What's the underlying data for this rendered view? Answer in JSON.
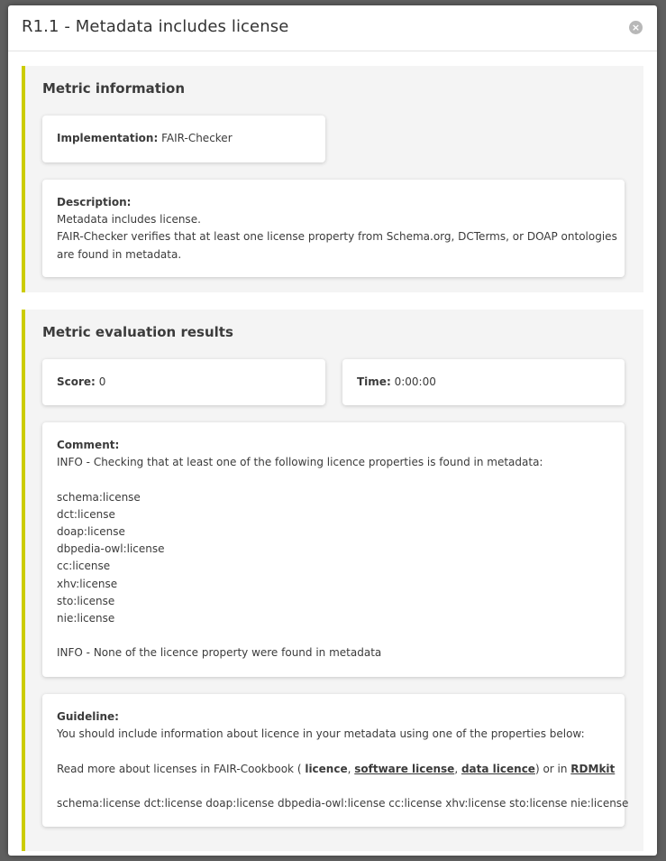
{
  "modal": {
    "title": "R1.1 - Metadata includes license",
    "close_icon": "×"
  },
  "metric_info": {
    "heading": "Metric information",
    "implementation_label": "Implementation:",
    "implementation_value": "FAIR-Checker",
    "description_label": "Description:",
    "description_lines": [
      "Metadata includes license.",
      "FAIR-Checker verifies that at least one license property from Schema.org, DCTerms, or DOAP ontologies",
      "are found in metadata."
    ]
  },
  "results": {
    "heading": "Metric evaluation results",
    "score_label": "Score:",
    "score_value": "0",
    "time_label": "Time:",
    "time_value": "0:00:00",
    "comment_label": "Comment:",
    "comment_intro": "INFO - Checking that at least one of the following licence properties is found in metadata:",
    "properties": [
      "schema:license",
      "dct:license",
      "doap:license",
      "dbpedia-owl:license",
      "cc:license",
      "xhv:license",
      "sto:license",
      "nie:license"
    ],
    "comment_result": "INFO - None of the licence property were found in metadata",
    "guideline_label": "Guideline:",
    "guideline_text": "You should include information about licence in your metadata using one of the properties below:",
    "read_more_prefix": "Read more about licenses in FAIR-Cookbook ( ",
    "link_licence": "licence",
    "sep1": ", ",
    "link_software_license": "software license",
    "sep2": ", ",
    "link_data_licence": "data licence",
    "read_more_middle": ") or in ",
    "link_rdmkit": "RDMkit",
    "property_list": "schema:license dct:license doap:license dbpedia-owl:license cc:license xhv:license sto:license nie:license"
  }
}
